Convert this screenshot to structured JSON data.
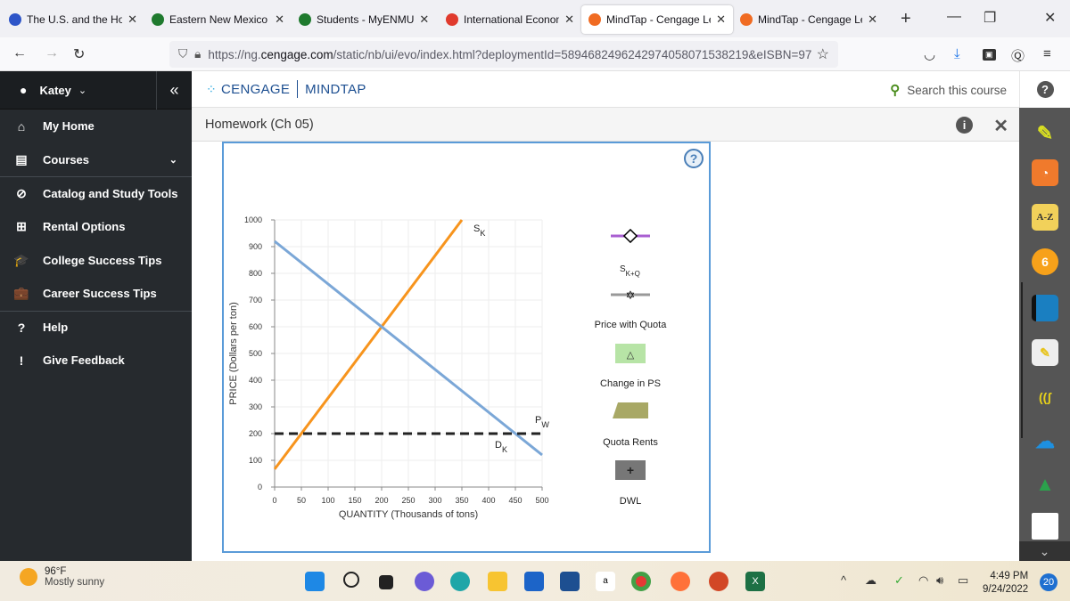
{
  "browser": {
    "tabs": [
      {
        "title": "The U.S. and the Holoc",
        "favicon": "pbs-icon",
        "color": "#2e55c8",
        "active": false
      },
      {
        "title": "Eastern New Mexico U",
        "favicon": "paw-icon",
        "color": "#1f7a2e",
        "active": false
      },
      {
        "title": "Students - MyENMU",
        "favicon": "paw-square-icon",
        "color": "#1f7a2e",
        "active": false
      },
      {
        "title": "International Economic",
        "favicon": "cengage-ring-icon",
        "color": "#e03a2d",
        "active": false
      },
      {
        "title": "MindTap - Cengage Le",
        "favicon": "mindtap-icon",
        "color": "#f06b22",
        "active": true
      },
      {
        "title": "MindTap - Cengage Le",
        "favicon": "mindtap-icon",
        "color": "#f06b22",
        "active": false
      }
    ],
    "new_tab_label": "+",
    "url_prefix": "https://ng.",
    "url_domain": "cengage.com",
    "url_rest": "/static/nb/ui/evo/index.html?deploymentId=5894682496242974058071538219&eISBN=97"
  },
  "sidebar": {
    "user": "Katey",
    "collapse": "«",
    "items": [
      {
        "label": "My Home",
        "icon": "⌂"
      },
      {
        "label": "Courses",
        "icon": "▤"
      },
      {
        "label": "Catalog and Study Tools",
        "icon": "⊘"
      },
      {
        "label": "Rental Options",
        "icon": "⊞"
      },
      {
        "label": "College Success Tips",
        "icon": "🎓"
      },
      {
        "label": "Career Success Tips",
        "icon": "💼"
      },
      {
        "label": "Help",
        "icon": "?"
      },
      {
        "label": "Give Feedback",
        "icon": "!"
      }
    ]
  },
  "header": {
    "brand": "CENGAGE",
    "product": "MINDTAP",
    "search_placeholder": "Search this course",
    "help": "?"
  },
  "subheader": {
    "title": "Homework (Ch 05)",
    "info": "i",
    "close": "✕"
  },
  "graph": {
    "help": "?",
    "legend": [
      {
        "label": "S",
        "sub": "K+Q",
        "symbol": "diamond-line",
        "color": "#a95fd1"
      },
      {
        "label": "Price with Quota",
        "symbol": "star-line",
        "color": "#999999"
      },
      {
        "label": "Change in PS",
        "symbol": "triangle-box",
        "color": "#b7e4a6"
      },
      {
        "label": "Quota Rents",
        "symbol": "trapezoid",
        "color": "#a8a865"
      },
      {
        "label": "DWL",
        "symbol": "plus-box",
        "color": "#777777"
      }
    ]
  },
  "chart_data": {
    "type": "line",
    "title": "",
    "xlabel": "QUANTITY (Thousands of tons)",
    "ylabel": "PRICE (Dollars per ton)",
    "xlim": [
      0,
      500
    ],
    "ylim": [
      0,
      1000
    ],
    "xticks": [
      0,
      50,
      100,
      150,
      200,
      250,
      300,
      350,
      400,
      450,
      500
    ],
    "yticks": [
      0,
      100,
      200,
      300,
      400,
      500,
      600,
      700,
      800,
      900,
      1000
    ],
    "grid": true,
    "series": [
      {
        "name": "S",
        "sub": "K",
        "color": "#f7941d",
        "style": "solid",
        "points": [
          [
            0,
            67
          ],
          [
            350,
            1000
          ]
        ]
      },
      {
        "name": "D",
        "sub": "K",
        "color": "#7ba7d7",
        "style": "solid",
        "points": [
          [
            0,
            920
          ],
          [
            500,
            120
          ]
        ]
      },
      {
        "name": "P",
        "sub": "W",
        "color": "#222222",
        "style": "dashed",
        "points": [
          [
            0,
            200
          ],
          [
            500,
            200
          ]
        ]
      }
    ]
  },
  "taskbar": {
    "temperature": "96°F",
    "weather": "Mostly sunny",
    "time": "4:49 PM",
    "date": "9/24/2022",
    "notifications": "20"
  }
}
